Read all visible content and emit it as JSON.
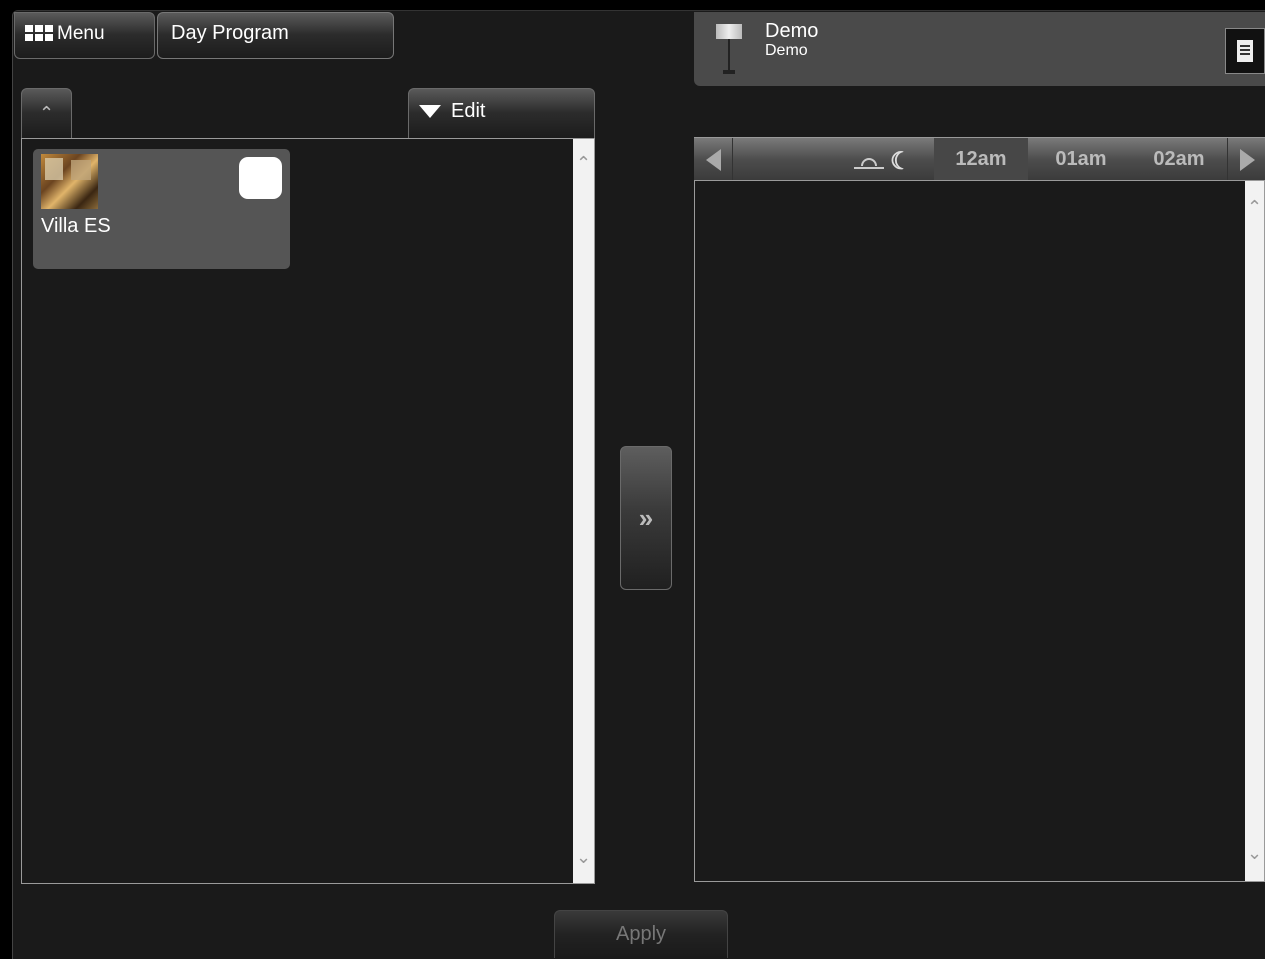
{
  "header": {
    "menu_label": "Menu",
    "program_label": "Day Program"
  },
  "left_panel": {
    "up_icon": "chevron-up-icon",
    "edit_label": "Edit",
    "items": [
      {
        "label": "Villa ES",
        "selected": false
      }
    ]
  },
  "transfer": {
    "icon": "double-chevron-right-icon",
    "glyph": "»"
  },
  "device": {
    "name": "Demo",
    "subtitle": "Demo",
    "icon": "pendant-lamp-icon",
    "action_icon": "notes-icon"
  },
  "timeline": {
    "prev_icon": "triangle-left-icon",
    "next_icon": "triangle-right-icon",
    "sun_icon": "sunrise-icon",
    "moon_glyph": "☾",
    "hours": [
      "12am",
      "01am",
      "02am"
    ],
    "current_hour": "12am"
  },
  "footer": {
    "apply_label": "Apply"
  },
  "colors": {
    "background": "#1a1a1a",
    "panel": "#4a4a4a",
    "card": "#555555",
    "scrollbar": "#f2f2f2"
  }
}
